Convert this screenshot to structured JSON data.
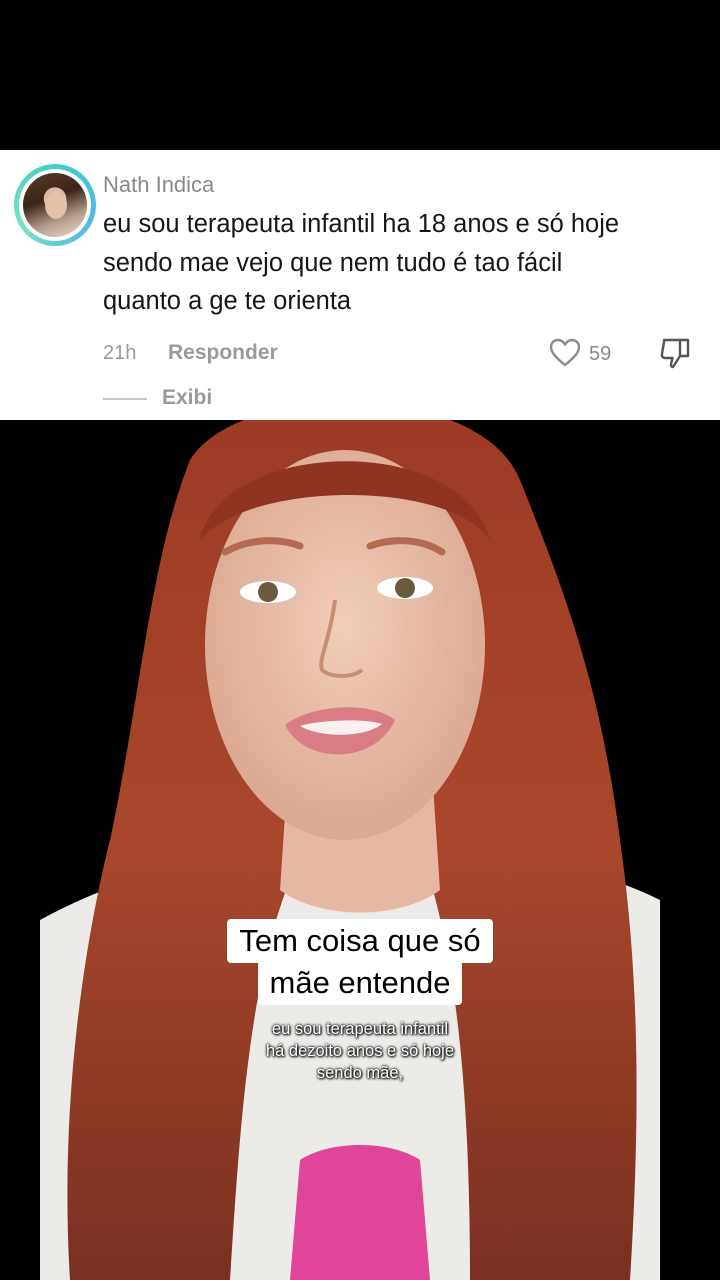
{
  "comment": {
    "author": "Nath Indica",
    "text_lines": [
      "eu sou terapeuta infantil ha 18 anos e só hoje",
      "sendo mae vejo que nem tudo é tao fácil",
      "quanto a ge te orienta"
    ],
    "time": "21h",
    "reply_label": "Responder",
    "like_count": "59",
    "view_replies_label": "Exibi"
  },
  "video": {
    "caption_lines": [
      "Tem coisa que só",
      "mãe entende"
    ],
    "subtitle_lines": [
      "eu sou terapeuta infantil",
      "há dezoito anos e só hoje",
      "sendo mãe,"
    ]
  },
  "icons": {
    "like": "heart-outline-icon",
    "dislike": "thumbs-down-icon"
  },
  "colors": {
    "avatar_ring": "#3fd0c9",
    "card_bg": "#ffffff",
    "hair": "#a8452c"
  }
}
